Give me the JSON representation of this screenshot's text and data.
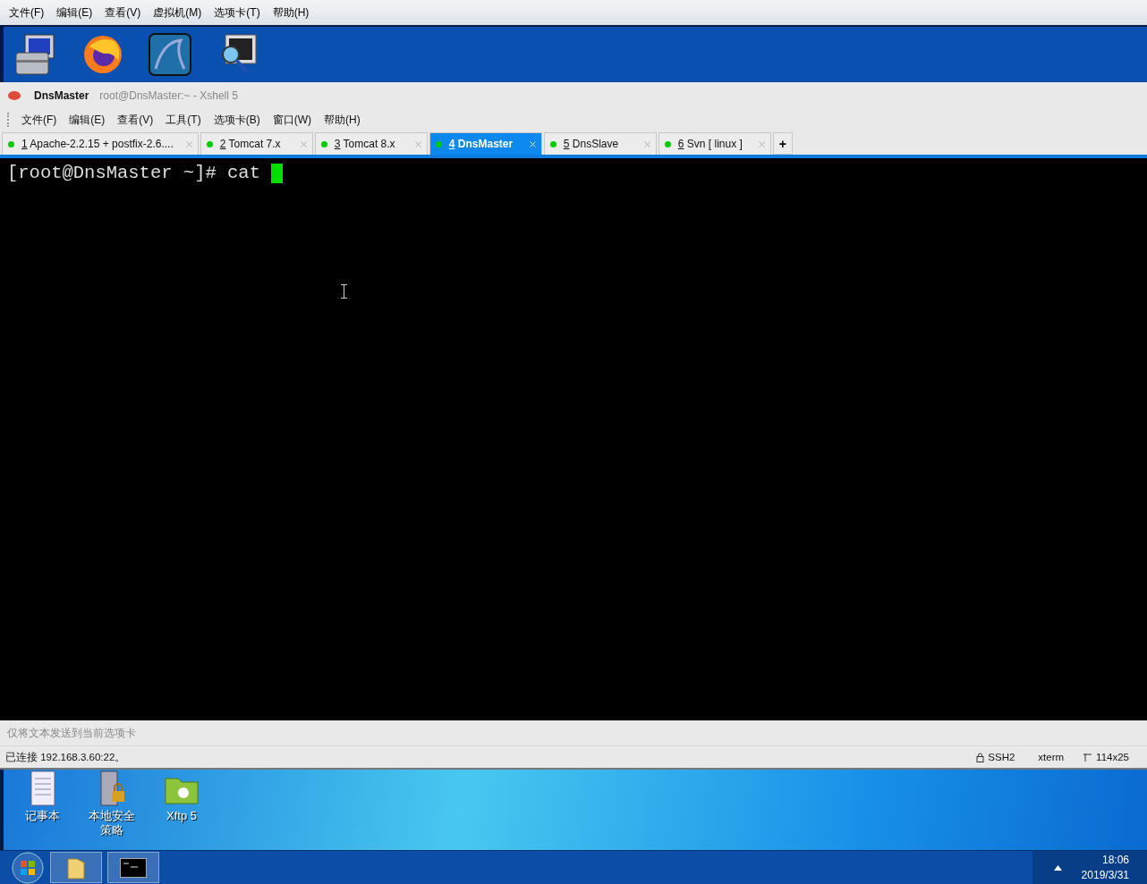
{
  "vm_menu": [
    "文件(F)",
    "编辑(E)",
    "查看(V)",
    "虚拟机(M)",
    "选项卡(T)",
    "帮助(H)"
  ],
  "xshell": {
    "session": "DnsMaster",
    "title": "root@DnsMaster:~ - Xshell 5",
    "menu": [
      "文件(F)",
      "编辑(E)",
      "查看(V)",
      "工具(T)",
      "选项卡(B)",
      "窗口(W)",
      "帮助(H)"
    ],
    "tabs": [
      {
        "number": "1",
        "label": "Apache-2.2.15 + postfix-2.6....",
        "selected": false
      },
      {
        "number": "2",
        "label": "Tomcat 7.x",
        "selected": false
      },
      {
        "number": "3",
        "label": "Tomcat 8.x",
        "selected": false
      },
      {
        "number": "4",
        "label": "DnsMaster",
        "selected": true
      },
      {
        "number": "5",
        "label": "DnsSlave",
        "selected": false
      },
      {
        "number": "6",
        "label": "Svn [ linux ]",
        "selected": false
      }
    ],
    "add_tab": "+",
    "terminal": {
      "prompt": "[root@DnsMaster ~]# cat "
    },
    "send_bar": {
      "placeholder": "仅将文本发送到当前选项卡"
    },
    "status": {
      "connection": "已连接 192.168.3.60:22。",
      "protocol": "SSH2",
      "term": "xterm",
      "size": "114x25"
    }
  },
  "desktop_icons": [
    {
      "kind": "notepad",
      "label": "记事本"
    },
    {
      "kind": "security",
      "label": "本地安全策略"
    },
    {
      "kind": "folder",
      "label": "Xftp 5"
    }
  ],
  "clock": {
    "time": "18:06",
    "date": "2019/3/31"
  }
}
